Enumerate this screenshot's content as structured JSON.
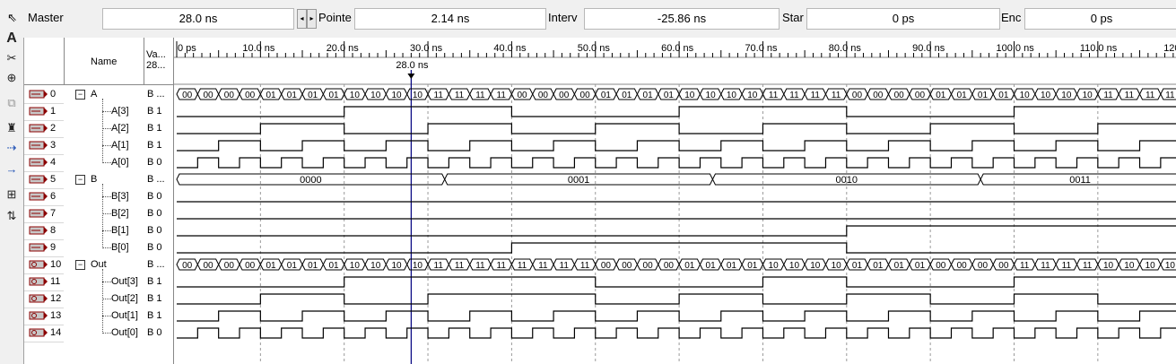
{
  "toolbar_top": {
    "master_label": "Master",
    "master_value": "28.0 ns",
    "pointer_label": "Pointe",
    "pointer_value": "2.14 ns",
    "interval_label": "Interv",
    "interval_value": "-25.86 ns",
    "start_label": "Star",
    "start_value": "0 ps",
    "end_label": "Enc",
    "end_value": "0 ps"
  },
  "tools": [
    "select-icon",
    "text-tool-icon",
    "waveform-editing-icon",
    "zoom-icon",
    "copy-icon",
    "find-icon",
    "find-next-icon",
    "replace-icon",
    "group-icon",
    "sort-icon"
  ],
  "headers": {
    "name": "Name",
    "value_line1": "Va...",
    "value_line2": "28..."
  },
  "timeline": {
    "ticks": [
      "0 ps",
      "10.0 ns",
      "20.0 ns",
      "30.0 ns",
      "40.0 ns",
      "50.0 ns",
      "60.0 ns",
      "70.0 ns",
      "80.0 ns",
      "90.0 ns",
      "100.0 ns",
      "110.0 ns",
      "120"
    ],
    "master_cursor_label": "28.0 ns",
    "master_cursor_ns": 28.0,
    "period_ns": 2.5
  },
  "signals": [
    {
      "index": "0",
      "name": "A",
      "value": "B ...",
      "kind": "bus_in",
      "group": true
    },
    {
      "index": "1",
      "name": "A[3]",
      "value": "B 1",
      "kind": "in"
    },
    {
      "index": "2",
      "name": "A[2]",
      "value": "B 1",
      "kind": "in"
    },
    {
      "index": "3",
      "name": "A[1]",
      "value": "B 1",
      "kind": "in"
    },
    {
      "index": "4",
      "name": "A[0]",
      "value": "B 0",
      "kind": "in"
    },
    {
      "index": "5",
      "name": "B",
      "value": "B ...",
      "kind": "bus_in",
      "group": true
    },
    {
      "index": "6",
      "name": "B[3]",
      "value": "B 0",
      "kind": "in"
    },
    {
      "index": "7",
      "name": "B[2]",
      "value": "B 0",
      "kind": "in"
    },
    {
      "index": "8",
      "name": "B[1]",
      "value": "B 0",
      "kind": "in"
    },
    {
      "index": "9",
      "name": "B[0]",
      "value": "B 0",
      "kind": "in"
    },
    {
      "index": "10",
      "name": "Out",
      "value": "B ...",
      "kind": "bus_out",
      "group": true
    },
    {
      "index": "11",
      "name": "Out[3]",
      "value": "B 1",
      "kind": "out"
    },
    {
      "index": "12",
      "name": "Out[2]",
      "value": "B 1",
      "kind": "out"
    },
    {
      "index": "13",
      "name": "Out[1]",
      "value": "B 1",
      "kind": "out"
    },
    {
      "index": "14",
      "name": "Out[0]",
      "value": "B 0",
      "kind": "out"
    }
  ],
  "bus_B_segments": [
    {
      "from_ns": 0,
      "to_ns": 32,
      "label": "0000"
    },
    {
      "from_ns": 32,
      "to_ns": 64,
      "label": "0001"
    },
    {
      "from_ns": 64,
      "to_ns": 96,
      "label": "0010"
    },
    {
      "from_ns": 96,
      "to_ns": 128,
      "label": "0011"
    }
  ],
  "bus_A_labels": [
    "00",
    "00",
    "01",
    "01",
    "10",
    "10",
    "11",
    "11"
  ],
  "bus_Out_pattern_labels": [
    [
      "00",
      "00",
      "01",
      "01",
      "10",
      "10",
      "11",
      "11"
    ],
    [
      "11",
      "11",
      "00",
      "00",
      "01",
      "01",
      "10",
      "10"
    ],
    [
      "01",
      "01",
      "00",
      "00",
      "11",
      "11",
      "10",
      "10"
    ],
    [
      "01",
      "01",
      "00",
      "00",
      "11",
      "11",
      "10",
      "10"
    ]
  ],
  "colors": {
    "waveform": "#000000",
    "cursor": "#000080",
    "grid": "#9a9a9a",
    "pin_in": "#8b0000",
    "pin_out": "#8b0000"
  }
}
